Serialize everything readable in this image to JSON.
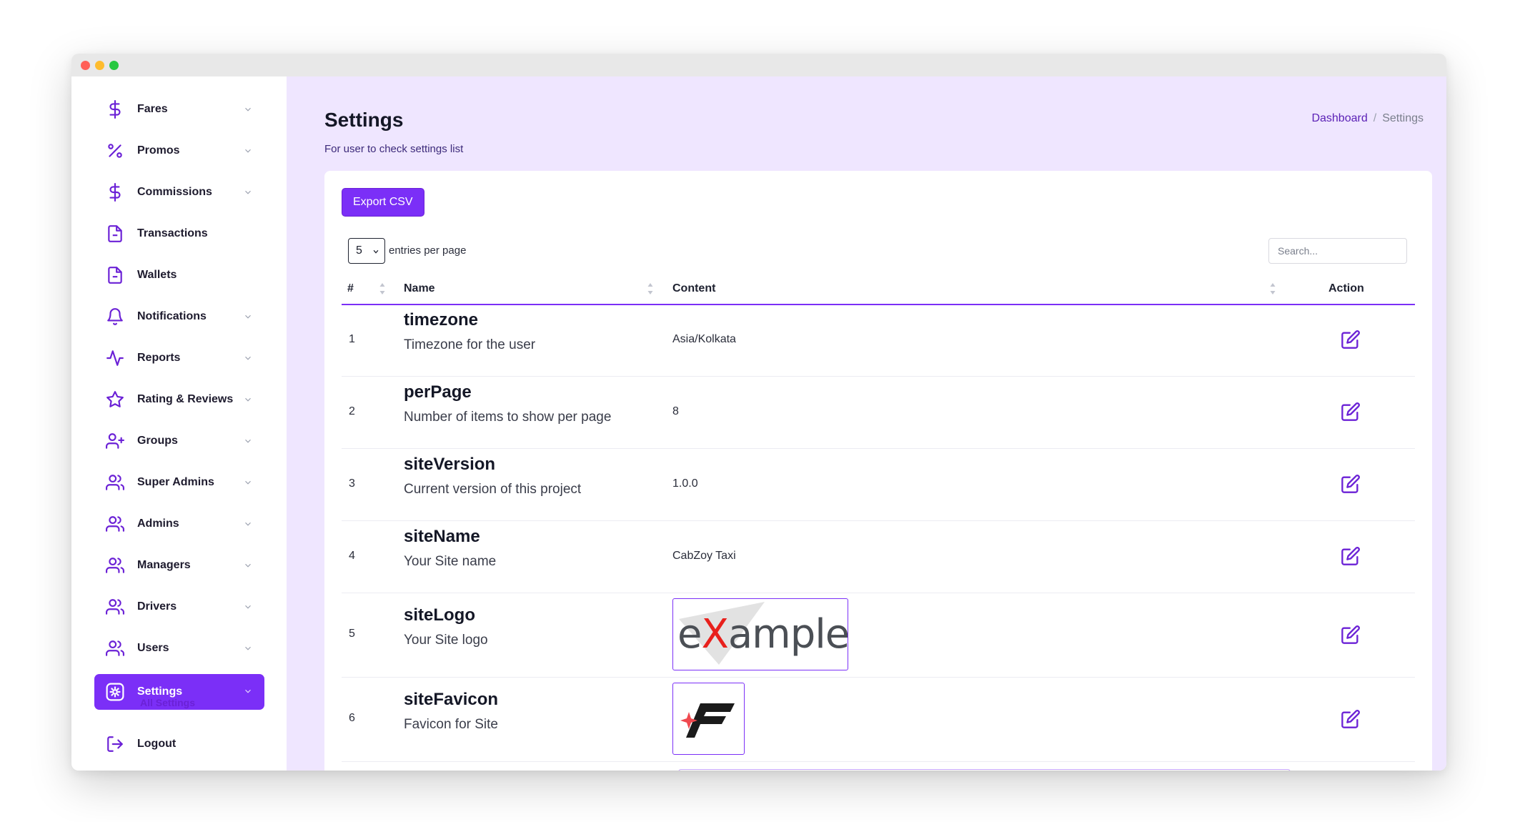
{
  "sidebar": {
    "items": [
      {
        "label": "Fares",
        "icon": "dollar-icon",
        "has_submenu": true
      },
      {
        "label": "Promos",
        "icon": "percent-icon",
        "has_submenu": true
      },
      {
        "label": "Commissions",
        "icon": "dollar-icon",
        "has_submenu": true
      },
      {
        "label": "Transactions",
        "icon": "file-icon",
        "has_submenu": false
      },
      {
        "label": "Wallets",
        "icon": "file-icon",
        "has_submenu": false
      },
      {
        "label": "Notifications",
        "icon": "bell-icon",
        "has_submenu": true
      },
      {
        "label": "Reports",
        "icon": "activity-icon",
        "has_submenu": true
      },
      {
        "label": "Rating & Reviews",
        "icon": "star-icon",
        "has_submenu": true
      },
      {
        "label": "Groups",
        "icon": "user-plus-icon",
        "has_submenu": true
      },
      {
        "label": "Super Admins",
        "icon": "users-icon",
        "has_submenu": true
      },
      {
        "label": "Admins",
        "icon": "users-icon",
        "has_submenu": true
      },
      {
        "label": "Managers",
        "icon": "users-icon",
        "has_submenu": true
      },
      {
        "label": "Drivers",
        "icon": "users-icon",
        "has_submenu": true
      },
      {
        "label": "Users",
        "icon": "users-icon",
        "has_submenu": true
      },
      {
        "label": "Settings",
        "icon": "gear-icon",
        "has_submenu": true,
        "active": true
      }
    ],
    "settings_subitem": "All Settings",
    "logout_label": "Logout"
  },
  "header": {
    "title": "Settings",
    "subtitle": "For user to check settings list",
    "breadcrumb": {
      "home": "Dashboard",
      "separator": "/",
      "current": "Settings"
    }
  },
  "toolbar": {
    "export_label": "Export CSV",
    "per_page_value": "5",
    "per_page_label": "entries per page",
    "search_placeholder": "Search..."
  },
  "table": {
    "columns": {
      "num": "#",
      "name": "Name",
      "content": "Content",
      "action": "Action"
    },
    "rows": [
      {
        "num": "1",
        "name": "timezone",
        "desc": "Timezone for the user",
        "content": "Asia/Kolkata"
      },
      {
        "num": "2",
        "name": "perPage",
        "desc": "Number of items to show per page",
        "content": "8"
      },
      {
        "num": "3",
        "name": "siteVersion",
        "desc": "Current version of this project",
        "content": "1.0.0"
      },
      {
        "num": "4",
        "name": "siteName",
        "desc": "Your Site name",
        "content": "CabZoy Taxi"
      },
      {
        "num": "5",
        "name": "siteLogo",
        "desc": "Your Site logo",
        "content_logo": {
          "text_prefix": "e",
          "text_x": "X",
          "text_suffix": "ample",
          "trademark": "™"
        }
      },
      {
        "num": "6",
        "name": "siteFavicon",
        "desc": "Favicon for Site"
      }
    ]
  },
  "colors": {
    "accent": "#7b2ff7",
    "content_bg": "#efe6ff",
    "logo_red": "#e8201c",
    "logo_gray": "#4b4f55"
  }
}
